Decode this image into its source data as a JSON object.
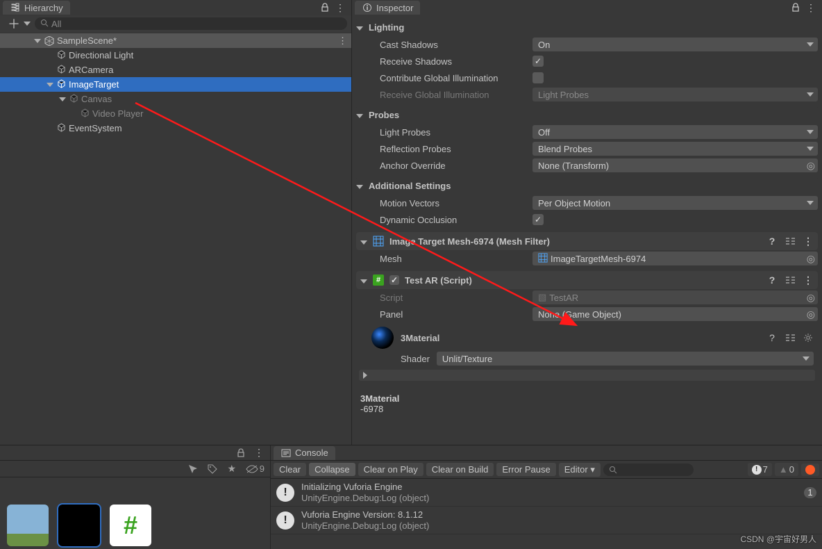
{
  "hierarchy": {
    "tab_label": "Hierarchy",
    "search_placeholder": "All",
    "nodes": {
      "scene": "SampleScene*",
      "n0": "Directional Light",
      "n1": "ARCamera",
      "n2": "ImageTarget",
      "n3": "Canvas",
      "n4": "Video Player",
      "n5": "EventSystem"
    }
  },
  "inspector": {
    "tab_label": "Inspector",
    "lighting": {
      "title": "Lighting",
      "cast_shadows": {
        "label": "Cast Shadows",
        "value": "On"
      },
      "receive_shadows": {
        "label": "Receive Shadows",
        "checked": true
      },
      "contribute_gi": {
        "label": "Contribute Global Illumination",
        "checked": false
      },
      "receive_gi": {
        "label": "Receive Global Illumination",
        "value": "Light Probes"
      }
    },
    "probes": {
      "title": "Probes",
      "light_probes": {
        "label": "Light Probes",
        "value": "Off"
      },
      "reflection_probes": {
        "label": "Reflection Probes",
        "value": "Blend Probes"
      },
      "anchor_override": {
        "label": "Anchor Override",
        "value": "None (Transform)"
      }
    },
    "additional": {
      "title": "Additional Settings",
      "motion_vectors": {
        "label": "Motion Vectors",
        "value": "Per Object Motion"
      },
      "dynamic_occlusion": {
        "label": "Dynamic Occlusion",
        "checked": true
      }
    },
    "mesh_filter": {
      "title": "Image Target Mesh-6974 (Mesh Filter)",
      "mesh": {
        "label": "Mesh",
        "value": "ImageTargetMesh-6974"
      }
    },
    "script_comp": {
      "title": "Test AR (Script)",
      "script": {
        "label": "Script",
        "value": "TestAR"
      },
      "panel": {
        "label": "Panel",
        "value": "None (Game Object)"
      }
    },
    "material": {
      "name": "3Material",
      "shader_label": "Shader",
      "shader_value": "Unlit/Texture"
    },
    "preview_head": "3Material",
    "preview_sub": "-6978"
  },
  "console": {
    "tab_label": "Console",
    "buttons": {
      "clear": "Clear",
      "collapse": "Collapse",
      "clear_play": "Clear on Play",
      "clear_build": "Clear on Build",
      "error_pause": "Error Pause",
      "editor": "Editor ▾"
    },
    "counts": {
      "info": "7",
      "warn": "0",
      "error": ""
    },
    "logs": [
      {
        "l1": "Initializing Vuforia Engine",
        "l2": "UnityEngine.Debug:Log (object)",
        "count": "1"
      },
      {
        "l1": "Vuforia Engine Version: 8.1.12",
        "l2": "UnityEngine.Debug:Log (object)"
      }
    ]
  },
  "project": {
    "visibility_count": "9"
  },
  "watermark": "CSDN @宇宙好男人"
}
